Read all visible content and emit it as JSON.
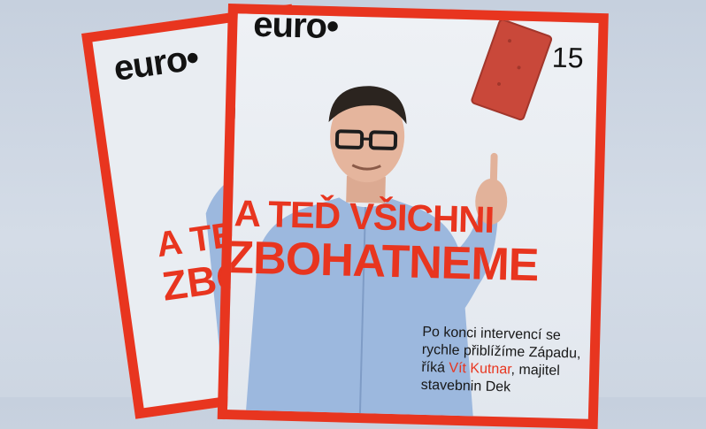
{
  "colors": {
    "accent": "#e8351f",
    "shirt": "#9cb8de",
    "background": "#cdd6e2"
  },
  "covers": [
    {
      "logo": "euro•",
      "headline_line1": "A TEĎ",
      "headline_line2": "ZBO"
    },
    {
      "logo": "euro•",
      "issue": "15",
      "headline_line1": "A TEĎ VŠICHNI",
      "headline_line2": "ZBOHATNEME",
      "body_before": "Po konci intervencí se rychle přiblížíme Západu, říká ",
      "body_name": "Vít Kutnar",
      "body_after": ", majitel stavebnin Dek"
    }
  ]
}
